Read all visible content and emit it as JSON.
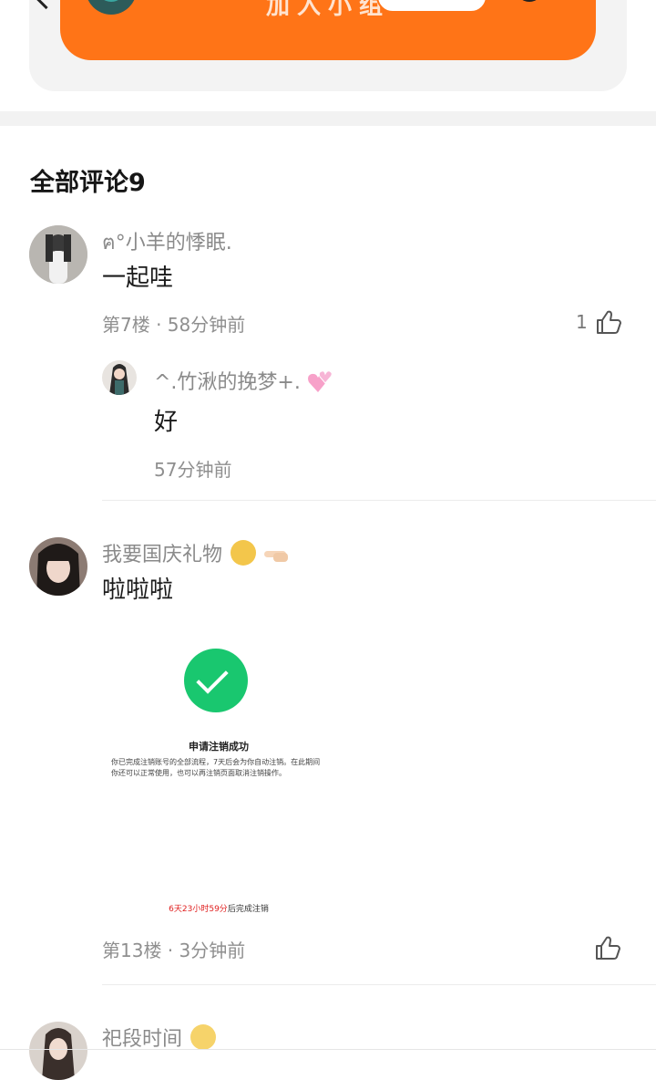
{
  "top": {
    "cta_label": "加入小组"
  },
  "section": {
    "title": "全部评论9"
  },
  "comments": [
    {
      "nickname": "ฅ°小羊的悸眠.",
      "content": "一起哇",
      "meta": "第7楼 · 58分钟前",
      "likes": "1",
      "reply": {
        "nickname": "^.竹湫的挽梦+.",
        "content": "好",
        "meta": "57分钟前"
      }
    },
    {
      "nickname": "我要国庆礼物",
      "content": "啦啦啦",
      "meta": "第13楼 · 3分钟前",
      "likes": "",
      "attachment": {
        "title": "申请注销成功",
        "body": "你已完成注销账号的全部流程，7天后会为你自动注销。在此期间你还可以正常使用，也可以再注销页面取消注销操作。",
        "footer_red": "6天23小时59分",
        "footer_rest": "后完成注销"
      }
    },
    {
      "nickname": "祀段时间"
    }
  ],
  "colors": {
    "accent": "#ff7417",
    "success": "#19c76f"
  },
  "icons": {
    "like": "thumbs-up-icon",
    "check": "check-icon"
  }
}
